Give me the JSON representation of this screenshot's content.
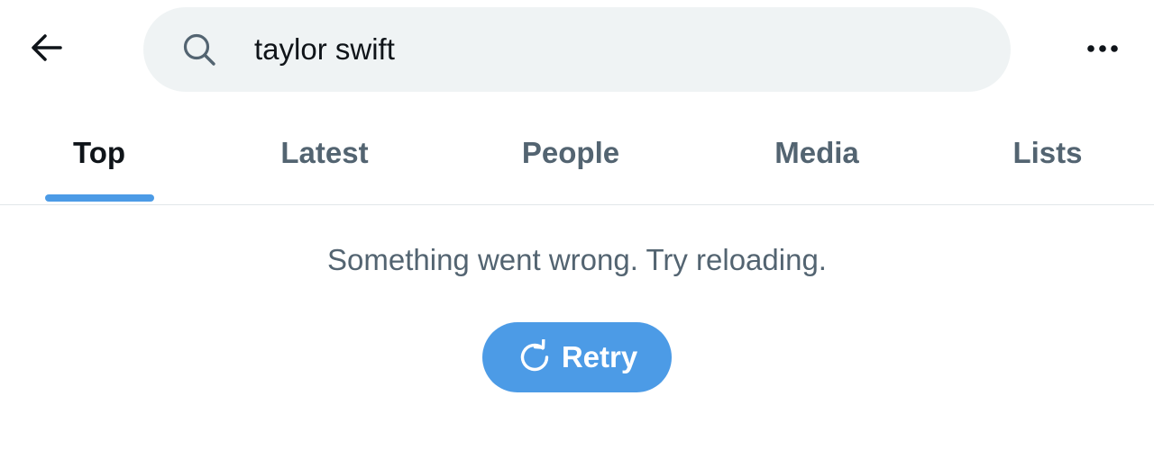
{
  "header": {
    "back_icon": "arrow-left-icon",
    "search": {
      "icon": "search-icon",
      "value": "taylor swift"
    },
    "more_icon": "more-horizontal-icon"
  },
  "tabs": [
    {
      "label": "Top",
      "active": true
    },
    {
      "label": "Latest",
      "active": false
    },
    {
      "label": "People",
      "active": false
    },
    {
      "label": "Media",
      "active": false
    },
    {
      "label": "Lists",
      "active": false
    }
  ],
  "error": {
    "message": "Something went wrong. Try reloading.",
    "retry_label": "Retry",
    "retry_icon": "refresh-icon"
  },
  "colors": {
    "accent": "#4c9be6",
    "search_bg": "#eff3f4",
    "text_primary": "#0f1419",
    "text_secondary": "#536471",
    "divider": "#e1e6e9"
  }
}
